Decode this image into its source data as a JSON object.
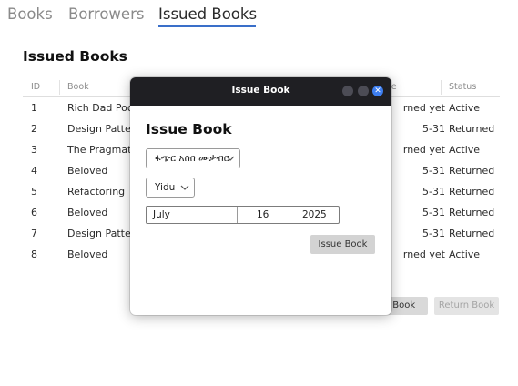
{
  "tabs": [
    "Books",
    "Borrowers",
    "Issued Books"
  ],
  "page_title": "Issued Books",
  "table": {
    "headers": {
      "id": "ID",
      "book": "Book",
      "date": "te",
      "status": "Status"
    },
    "rows": [
      {
        "id": "1",
        "book": "Rich Dad Poo",
        "date": "rned yet",
        "status": "Active"
      },
      {
        "id": "2",
        "book": "Design Patter",
        "date": "5-31",
        "status": "Returned"
      },
      {
        "id": "3",
        "book": "The Pragmati",
        "date": "rned yet",
        "status": "Active"
      },
      {
        "id": "4",
        "book": "Beloved",
        "date": "5-31",
        "status": "Returned"
      },
      {
        "id": "5",
        "book": "Refactoring",
        "date": "5-31",
        "status": "Returned"
      },
      {
        "id": "6",
        "book": "Beloved",
        "date": "5-31",
        "status": "Returned"
      },
      {
        "id": "7",
        "book": "Design Patter",
        "date": "5-31",
        "status": "Returned"
      },
      {
        "id": "8",
        "book": "Beloved",
        "date": "rned yet",
        "status": "Active"
      }
    ]
  },
  "buttons": {
    "issue_book": "e Book",
    "return_book": "Return Book"
  },
  "dialog": {
    "title": "Issue Book",
    "heading": "Issue Book",
    "borrower_select": "ፋጭር አስበ ሙቃብር",
    "book_select": "Yidu",
    "date": {
      "month": "July",
      "day": "16",
      "year": "2025"
    },
    "submit_label": "Issue Book",
    "close_glyph": "✕"
  }
}
